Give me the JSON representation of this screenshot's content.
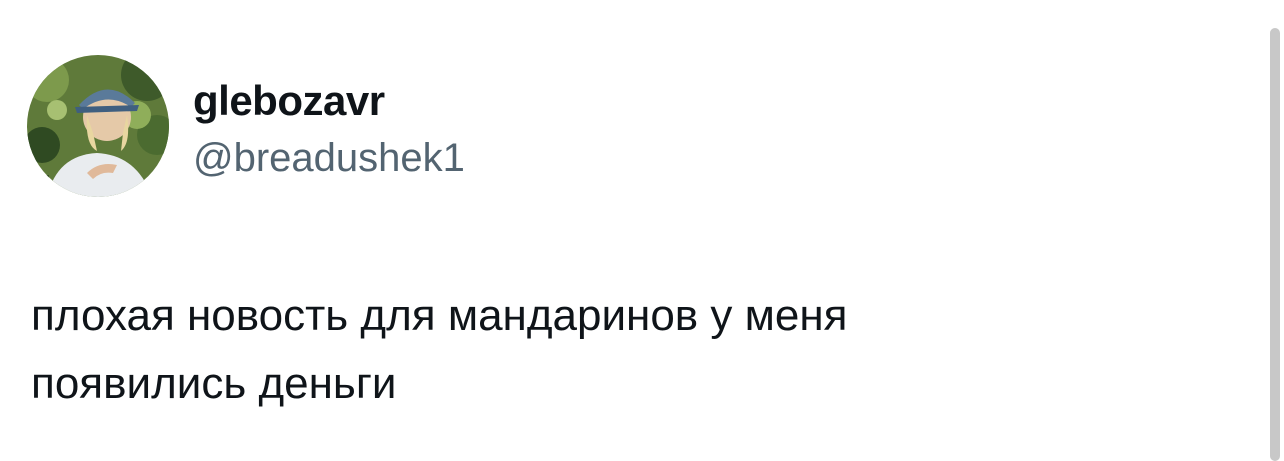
{
  "tweet": {
    "author": {
      "display_name": "glebozavr",
      "handle": "@breadushek1",
      "avatar_icon": "user-avatar-photo"
    },
    "text_lines": [
      "плохая новость для мандаринов у меня",
      "появились деньги"
    ]
  },
  "colors": {
    "name": "#0f1419",
    "handle": "#536471",
    "text": "#0f1419",
    "scrollbar": "#c8c8c8"
  }
}
